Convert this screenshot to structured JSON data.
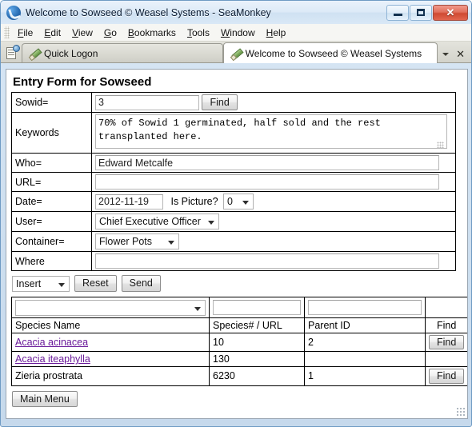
{
  "window": {
    "title": "Welcome to Sowseed © Weasel Systems - SeaMonkey",
    "app_icon": "seamonkey-logo-icon",
    "buttons": {
      "minimize": "minimize-icon",
      "maximize": "maximize-icon",
      "close": "✕"
    },
    "frame_color": "#c6d9ec",
    "titlebar_color": "#dceaf7",
    "close_button_color": "#cf4a32"
  },
  "menubar": {
    "items": [
      {
        "label": "File",
        "mnemonic": "F"
      },
      {
        "label": "Edit",
        "mnemonic": "E"
      },
      {
        "label": "View",
        "mnemonic": "V"
      },
      {
        "label": "Go",
        "mnemonic": "G"
      },
      {
        "label": "Bookmarks",
        "mnemonic": "B"
      },
      {
        "label": "Tools",
        "mnemonic": "T"
      },
      {
        "label": "Window",
        "mnemonic": "W"
      },
      {
        "label": "Help",
        "mnemonic": "H"
      }
    ]
  },
  "tabstrip": {
    "new_tab_icon": "new-tab-icon",
    "tabs": [
      {
        "label": "Quick Logon",
        "icon": "pencil-icon",
        "active": false
      },
      {
        "label": "Welcome to Sowseed © Weasel Systems",
        "icon": "pencil-icon",
        "active": true
      }
    ],
    "tab_list_icon": "chevron-down-icon",
    "close_tab_icon": "✕"
  },
  "page": {
    "title": "Entry Form for Sowseed",
    "form": {
      "rows": [
        {
          "label": "Sowid=",
          "value": "3"
        },
        {
          "label": "Keywords",
          "value": "70% of Sowid 1 germinated, half sold and the rest transplanted here."
        },
        {
          "label": "Who=",
          "value": "Edward Metcalfe"
        },
        {
          "label": "URL=",
          "value": ""
        },
        {
          "label": "Date=",
          "value": "2012-11-19"
        },
        {
          "label": "User=",
          "value": "Chief Executive Officer"
        },
        {
          "label": "Container=",
          "value": "Flower Pots"
        },
        {
          "label": "Where",
          "value": ""
        }
      ],
      "find_button": "Find",
      "is_picture_label": "Is Picture?",
      "is_picture_value": "0",
      "user_value": "Chief Executive Officer",
      "container_value": "Flower Pots",
      "mode_value": "Insert",
      "reset_button": "Reset",
      "send_button": "Send"
    },
    "list": {
      "filter_row": {
        "species_select": "",
        "number_input": "",
        "parent_input": ""
      },
      "headers": [
        "Species Name",
        "Species# / URL",
        "Parent ID",
        "Find"
      ],
      "rows": [
        {
          "name": "Acacia acinacea",
          "is_link": true,
          "number": "10",
          "parent": "2",
          "find": "Find",
          "has_find": true
        },
        {
          "name": "Acacia iteaphylla",
          "is_link": true,
          "number": "130",
          "parent": "",
          "find": "",
          "has_find": false
        },
        {
          "name": "Zieria prostrata",
          "is_link": false,
          "number": "6230",
          "parent": "1",
          "find": "Find",
          "has_find": true
        }
      ],
      "link_color": "#6a1a9a"
    },
    "main_menu_button": "Main Menu"
  }
}
